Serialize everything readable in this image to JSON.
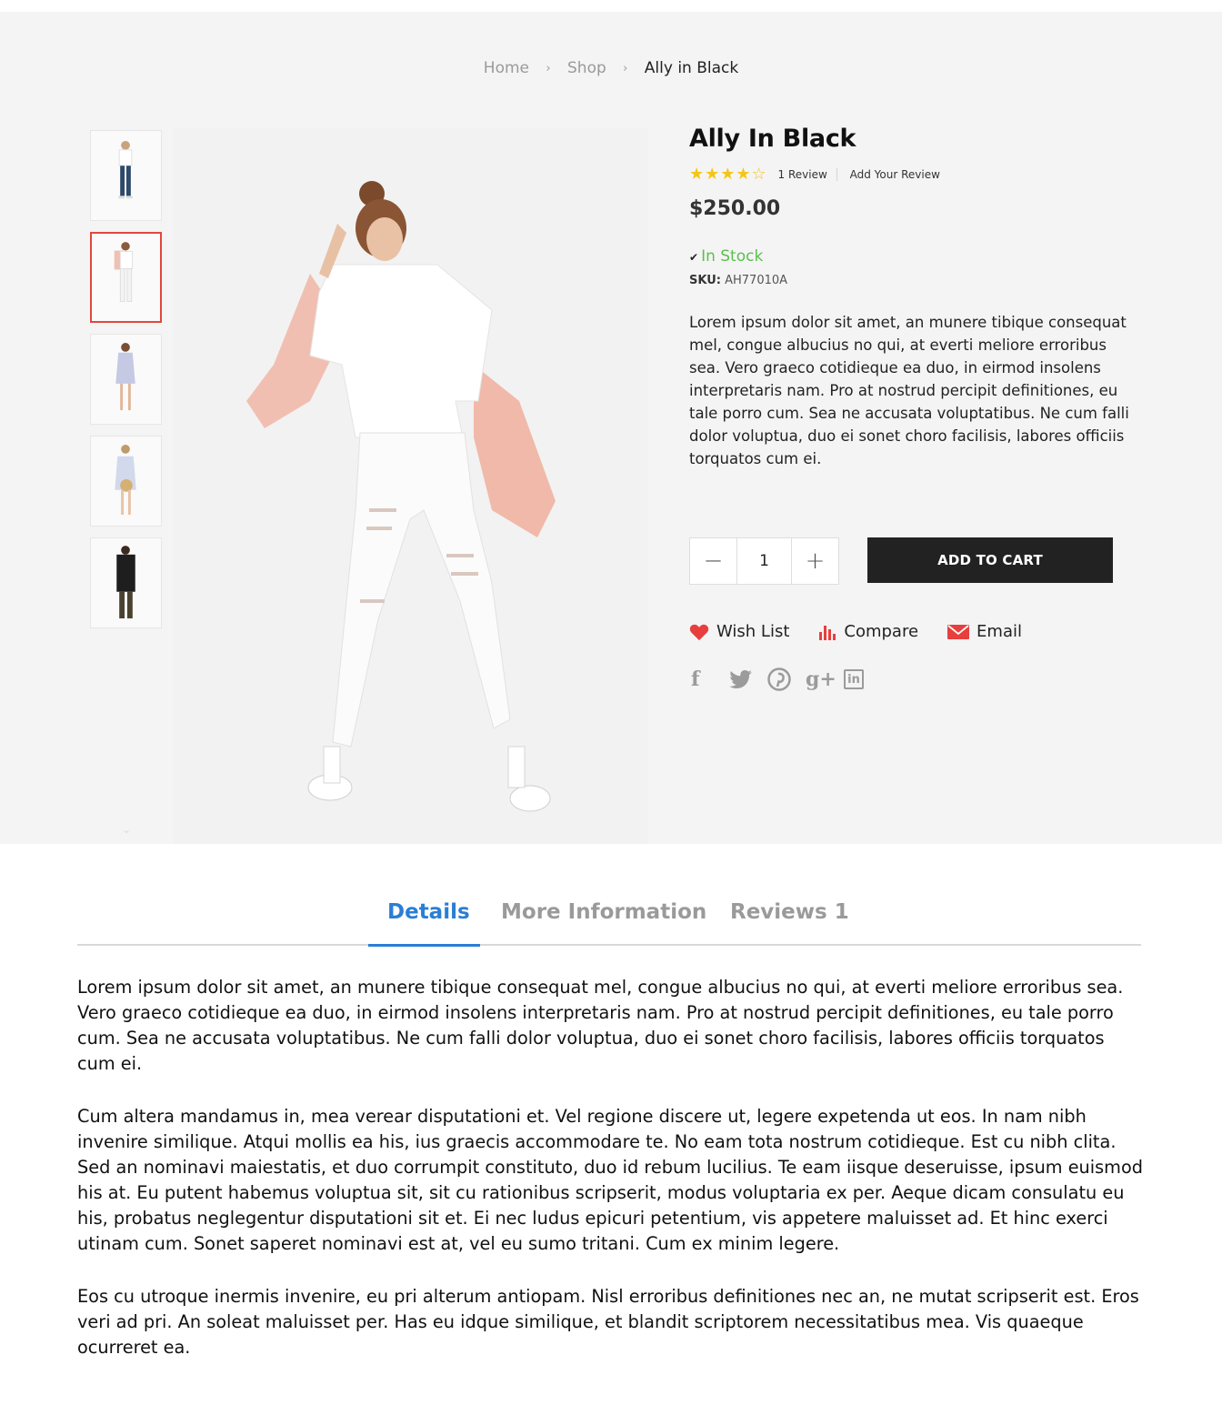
{
  "breadcrumb": {
    "home": "Home",
    "shop": "Shop",
    "current": "Ally in Black",
    "separator": "›"
  },
  "gallery": {
    "thumbnails": [
      "thumbnail-white-tee-jeans",
      "thumbnail-pink-jacket",
      "thumbnail-striped-dress",
      "thumbnail-off-shoulder-dress",
      "thumbnail-black-sweater"
    ],
    "active_thumbnail": 1,
    "down_arrow": "⌄"
  },
  "product": {
    "title": "Ally In Black",
    "rating": 4,
    "stars_filled": "★★★★",
    "stars_empty": "☆",
    "review_count": "1 Review",
    "add_review": "Add Your Review",
    "price": "$250.00",
    "stock_check": "✔",
    "stock": "In Stock",
    "sku_label": "SKU:",
    "sku_value": "AH77010A",
    "description": "Lorem ipsum dolor sit amet, an munere tibique consequat mel, congue albucius no qui, at everti meliore erroribus sea. Vero graeco cotidieque ea duo, in eirmod insolens interpretaris nam. Pro at nostrud percipit definitiones, eu tale porro cum. Sea ne accusata voluptatibus. Ne cum falli dolor voluptua, duo ei sonet choro facilisis, labores officiis torquatos cum ei."
  },
  "cart": {
    "minus": "−",
    "quantity": "1",
    "plus": "+",
    "add_to_cart": "ADD TO CART"
  },
  "actions": {
    "wishlist": "Wish List",
    "compare": "Compare",
    "email": "Email"
  },
  "social": {
    "facebook": "f",
    "google_plus": "g+",
    "linkedin": "in"
  },
  "tabs": {
    "details": "Details",
    "more_info": "More Information",
    "reviews": "Reviews 1"
  },
  "details_content": {
    "p1": "Lorem ipsum dolor sit amet, an munere tibique consequat mel, congue albucius no qui, at everti meliore erroribus sea. Vero graeco cotidieque ea duo, in eirmod insolens interpretaris nam. Pro at nostrud percipit definitiones, eu tale porro cum. Sea ne accusata voluptatibus. Ne cum falli dolor voluptua, duo ei sonet choro facilisis, labores officiis torquatos cum ei.",
    "p2": "Cum altera mandamus in, mea verear disputationi et. Vel regione discere ut, legere expetenda ut eos. In nam nibh invenire similique. Atqui mollis ea his, ius graecis accommodare te. No eam tota nostrum cotidieque. Est cu nibh clita. Sed an nominavi maiestatis, et duo corrumpit constituto, duo id rebum lucilius. Te eam iisque deseruisse, ipsum euismod his at. Eu putent habemus voluptua sit, sit cu rationibus scripserit, modus voluptaria ex per. Aeque dicam consulatu eu his, probatus neglegentur disputationi sit et. Ei nec ludus epicuri petentium, vis appetere maluisset ad. Et hinc exerci utinam cum. Sonet saperet nominavi est at, vel eu sumo tritani. Cum ex minim legere.",
    "p3": "Eos cu utroque inermis invenire, eu pri alterum antiopam. Nisl erroribus definitiones nec an, ne mutat scripserit est. Eros veri ad pri. An soleat maluisset per. Has eu idque similique, et blandit scriptorem necessitatibus mea. Vis quaeque ocurreret ea."
  },
  "colors": {
    "hero_bg": "#f4f4f4",
    "accent_blue": "#2a7fd4",
    "stock_green": "#5bbf4f",
    "star_yellow": "#f5c518",
    "active_thumb_border": "#e2473d",
    "heart_red": "#e83e3e",
    "button_dark": "#222222"
  }
}
